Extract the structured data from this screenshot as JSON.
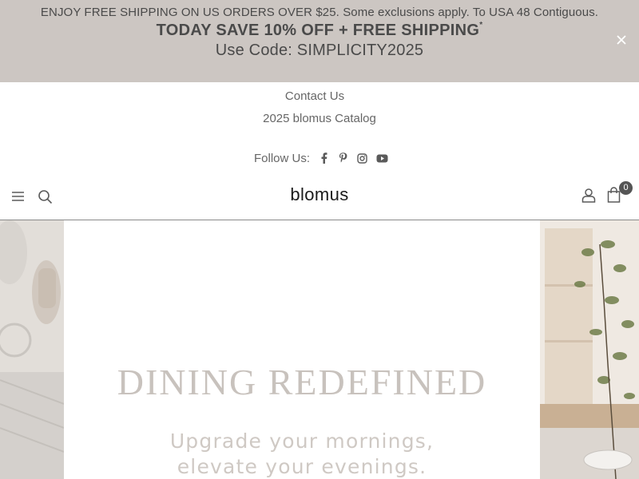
{
  "announcement": {
    "line1": "ENJOY FREE SHIPPING ON US ORDERS OVER $25. Some exclusions apply. To USA 48 Contiguous.",
    "line2": "TODAY SAVE 10% OFF + FREE SHIPPING",
    "line2_mark": "*",
    "line3": "Use Code: SIMPLICITY2025",
    "close_icon": "close-icon"
  },
  "top_links": {
    "contact": "Contact Us",
    "catalog": "2025 blomus Catalog"
  },
  "follow": {
    "label": "Follow Us:",
    "icons": [
      "facebook-icon",
      "pinterest-icon",
      "instagram-icon",
      "youtube-icon"
    ]
  },
  "header": {
    "logo": "blomus",
    "cart_count": "0",
    "icons": [
      "menu-icon",
      "search-icon",
      "account-icon",
      "cart-icon"
    ]
  },
  "hero": {
    "heading": "DINING REDEFINED",
    "sub1": "Upgrade your mornings,",
    "sub2": "elevate your evenings."
  },
  "colors": {
    "announcement_bg": "#ccc6c2",
    "text": "#5a5a5a",
    "hero_text": "#c8c2bd"
  }
}
